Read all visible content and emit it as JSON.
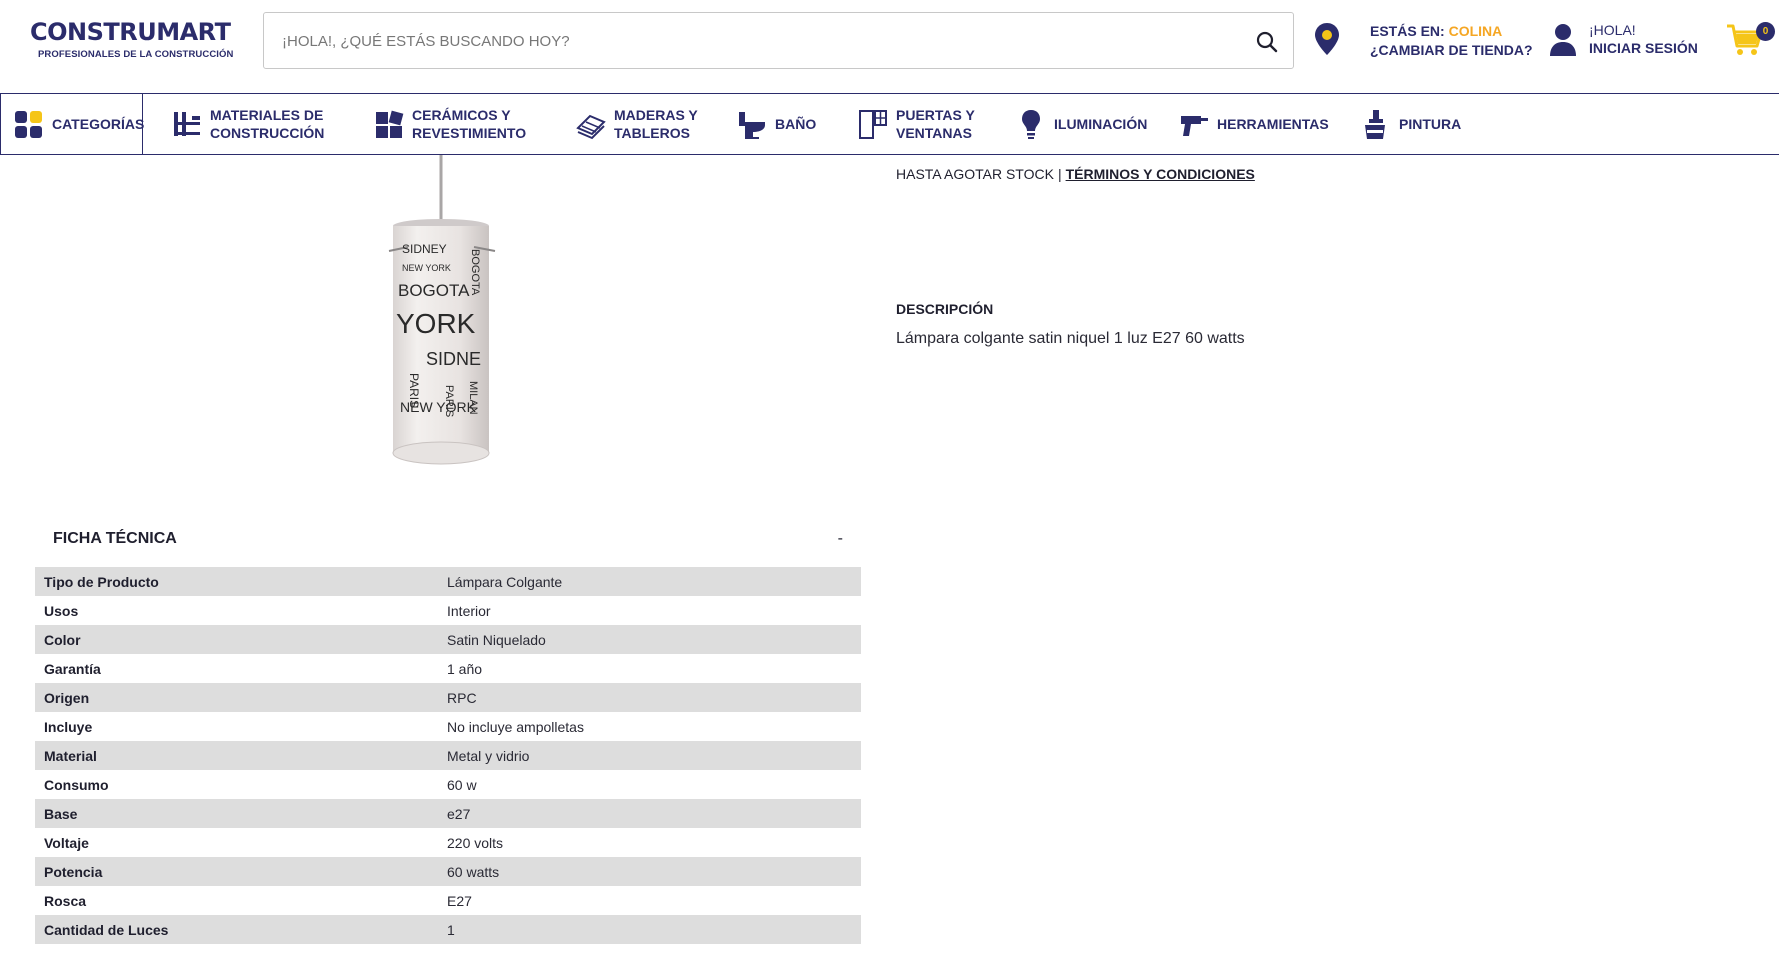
{
  "header": {
    "logo_main": "CONSTRUMART",
    "logo_sub": "PROFESIONALES DE LA CONSTRUCCIÓN",
    "search_placeholder": "¡HOLA!, ¿QUÉ ESTÁS BUSCANDO HOY?",
    "store_prefix": "ESTÁS EN:",
    "store_name": "COLINA",
    "store_change": "¿CAMBIAR DE TIENDA?",
    "login_greeting": "¡HOLA!",
    "login_label": "INICIAR SESIÓN",
    "cart_count": "0"
  },
  "nav": {
    "categories": "CATEGORÍAS",
    "items": [
      {
        "line1": "MATERIALES DE",
        "line2": "CONSTRUCCIÓN"
      },
      {
        "line1": "CERÁMICOS Y",
        "line2": "REVESTIMIENTO"
      },
      {
        "line1": "MADERAS Y",
        "line2": "TABLEROS"
      },
      {
        "line1": "BAÑO",
        "line2": ""
      },
      {
        "line1": "PUERTAS Y",
        "line2": "VENTANAS"
      },
      {
        "line1": "ILUMINACIÓN",
        "line2": ""
      },
      {
        "line1": "HERRAMIENTAS",
        "line2": ""
      },
      {
        "line1": "PINTURA",
        "line2": ""
      }
    ]
  },
  "product": {
    "stock_text": "HASTA AGOTAR STOCK",
    "stock_sep": "|",
    "terms_link": "TÉRMINOS Y CONDICIONES",
    "description_title": "DESCRIPCIÓN",
    "description_text": "Lámpara colgante satin niquel 1 luz E27 60 watts",
    "image_texts": [
      "SIDNEY",
      "NEW YORK",
      "BOGOTA",
      "YORK",
      "SIDNE",
      "PARIS",
      "PARIS",
      "MILAN",
      "BOGOTA",
      "NEW YORK"
    ]
  },
  "ficha": {
    "title": "FICHA TÉCNICA",
    "toggle": "-",
    "rows": [
      {
        "k": "Tipo de Producto",
        "v": "Lámpara Colgante"
      },
      {
        "k": "Usos",
        "v": "Interior"
      },
      {
        "k": "Color",
        "v": "Satin Niquelado"
      },
      {
        "k": "Garantía",
        "v": "1 año"
      },
      {
        "k": "Origen",
        "v": "RPC"
      },
      {
        "k": "Incluye",
        "v": "No incluye ampolletas"
      },
      {
        "k": "Material",
        "v": "Metal y vidrio"
      },
      {
        "k": "Consumo",
        "v": "60 w"
      },
      {
        "k": "Base",
        "v": "e27"
      },
      {
        "k": "Voltaje",
        "v": "220 volts"
      },
      {
        "k": "Potencia",
        "v": "60 watts"
      },
      {
        "k": "Rosca",
        "v": "E27"
      },
      {
        "k": "Cantidad de Luces",
        "v": "1"
      }
    ]
  },
  "colors": {
    "brand_navy": "#2b2c6b",
    "brand_yellow": "#f5a623",
    "row_gray": "#dddddd"
  }
}
